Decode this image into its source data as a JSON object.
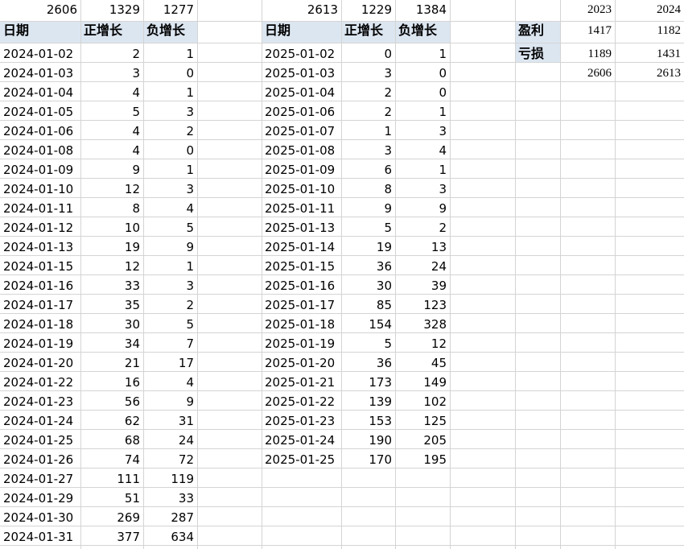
{
  "table_2024": {
    "totals": [
      "2606",
      "1329",
      "1277"
    ],
    "headers": [
      "日期",
      "正增长",
      "负增长"
    ],
    "rows": [
      [
        "2024-01-02",
        "2",
        "1"
      ],
      [
        "2024-01-03",
        "3",
        "0"
      ],
      [
        "2024-01-04",
        "4",
        "1"
      ],
      [
        "2024-01-05",
        "5",
        "3"
      ],
      [
        "2024-01-06",
        "4",
        "2"
      ],
      [
        "2024-01-08",
        "4",
        "0"
      ],
      [
        "2024-01-09",
        "9",
        "1"
      ],
      [
        "2024-01-10",
        "12",
        "3"
      ],
      [
        "2024-01-11",
        "8",
        "4"
      ],
      [
        "2024-01-12",
        "10",
        "5"
      ],
      [
        "2024-01-13",
        "19",
        "9"
      ],
      [
        "2024-01-15",
        "12",
        "1"
      ],
      [
        "2024-01-16",
        "33",
        "3"
      ],
      [
        "2024-01-17",
        "35",
        "2"
      ],
      [
        "2024-01-18",
        "30",
        "5"
      ],
      [
        "2024-01-19",
        "34",
        "7"
      ],
      [
        "2024-01-20",
        "21",
        "17"
      ],
      [
        "2024-01-22",
        "16",
        "4"
      ],
      [
        "2024-01-23",
        "56",
        "9"
      ],
      [
        "2024-01-24",
        "62",
        "31"
      ],
      [
        "2024-01-25",
        "68",
        "24"
      ],
      [
        "2024-01-26",
        "74",
        "72"
      ],
      [
        "2024-01-27",
        "111",
        "119"
      ],
      [
        "2024-01-29",
        "51",
        "33"
      ],
      [
        "2024-01-30",
        "269",
        "287"
      ],
      [
        "2024-01-31",
        "377",
        "634"
      ]
    ]
  },
  "table_2025": {
    "totals": [
      "2613",
      "1229",
      "1384"
    ],
    "headers": [
      "日期",
      "正增长",
      "负增长"
    ],
    "rows": [
      [
        "2025-01-02",
        "0",
        "1"
      ],
      [
        "2025-01-03",
        "3",
        "0"
      ],
      [
        "2025-01-04",
        "2",
        "0"
      ],
      [
        "2025-01-06",
        "2",
        "1"
      ],
      [
        "2025-01-07",
        "1",
        "3"
      ],
      [
        "2025-01-08",
        "3",
        "4"
      ],
      [
        "2025-01-09",
        "6",
        "1"
      ],
      [
        "2025-01-10",
        "8",
        "3"
      ],
      [
        "2025-01-11",
        "9",
        "9"
      ],
      [
        "2025-01-13",
        "5",
        "2"
      ],
      [
        "2025-01-14",
        "19",
        "13"
      ],
      [
        "2025-01-15",
        "36",
        "24"
      ],
      [
        "2025-01-16",
        "30",
        "39"
      ],
      [
        "2025-01-17",
        "85",
        "123"
      ],
      [
        "2025-01-18",
        "154",
        "328"
      ],
      [
        "2025-01-19",
        "5",
        "12"
      ],
      [
        "2025-01-20",
        "36",
        "45"
      ],
      [
        "2025-01-21",
        "173",
        "149"
      ],
      [
        "2025-01-22",
        "139",
        "102"
      ],
      [
        "2025-01-23",
        "153",
        "125"
      ],
      [
        "2025-01-24",
        "190",
        "205"
      ],
      [
        "2025-01-25",
        "170",
        "195"
      ]
    ]
  },
  "summary": {
    "years": [
      "2023",
      "2024"
    ],
    "profit_label": "盈利",
    "profit": [
      "1417",
      "1182"
    ],
    "loss_label": "亏损",
    "loss": [
      "1189",
      "1431"
    ],
    "totals": [
      "2606",
      "2613"
    ]
  },
  "colors": {
    "header_fill": "#dce6f1",
    "gridline": "#d4d4d4"
  }
}
